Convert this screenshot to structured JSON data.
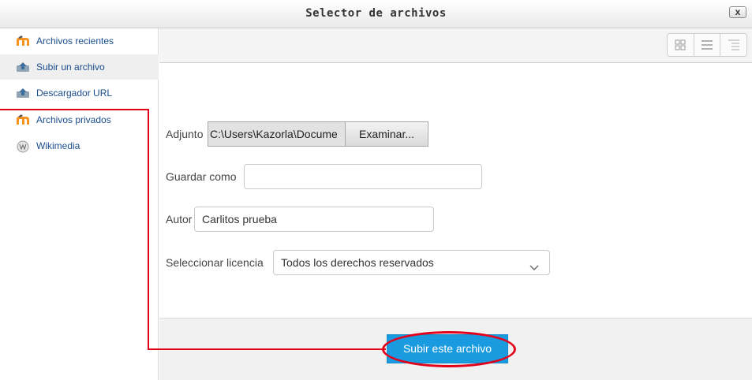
{
  "dialog": {
    "title": "Selector de archivos",
    "close_label": "x"
  },
  "sidebar": {
    "items": [
      {
        "label": "Archivos recientes",
        "icon": "moodle-icon"
      },
      {
        "label": "Subir un archivo",
        "icon": "upload-icon"
      },
      {
        "label": "Descargador URL",
        "icon": "upload-icon"
      },
      {
        "label": "Archivos privados",
        "icon": "moodle-icon"
      },
      {
        "label": "Wikimedia",
        "icon": "wikimedia-icon"
      }
    ]
  },
  "toolbar": {
    "view_icons": [
      "grid-view-icon",
      "list-view-icon",
      "tree-view-icon"
    ]
  },
  "form": {
    "attachment_label": "Adjunto",
    "attachment_path": "C:\\Users\\Kazorla\\Docume",
    "browse_label": "Examinar...",
    "save_as_label": "Guardar como",
    "save_as_value": "",
    "author_label": "Autor",
    "author_value": "Carlitos prueba",
    "license_label": "Seleccionar licencia",
    "license_value": "Todos los derechos reservados"
  },
  "footer": {
    "upload_label": "Subir este archivo"
  },
  "colors": {
    "accent": "#1a9be0",
    "highlight": "#e3001b",
    "link": "#1a4d8c"
  }
}
